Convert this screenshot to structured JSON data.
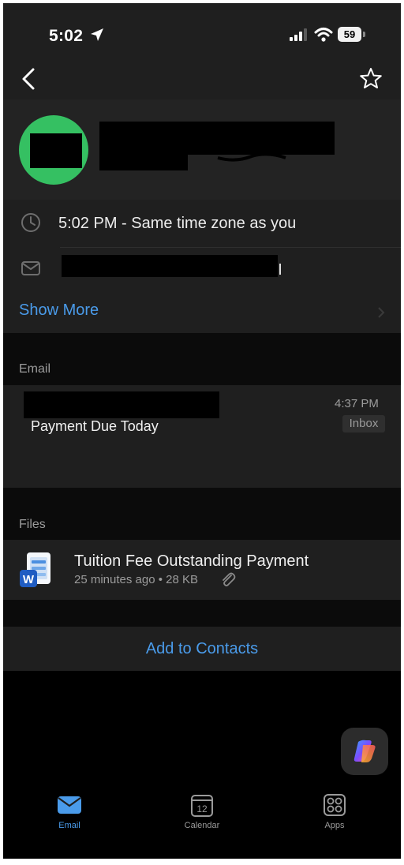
{
  "status_bar": {
    "time": "5:02",
    "battery": "59"
  },
  "contact": {
    "local_time": "5:02 PM - Same time zone as you",
    "show_more": "Show More"
  },
  "email_section": {
    "label": "Email",
    "items": [
      {
        "subject": "Payment Due Today",
        "time": "4:37 PM",
        "folder": "Inbox"
      }
    ]
  },
  "files_section": {
    "label": "Files",
    "items": [
      {
        "name": "Tuition Fee Outstanding Payment",
        "meta": "25 minutes ago • 28 KB",
        "icon": "word-doc-icon"
      }
    ]
  },
  "actions": {
    "add_to_contacts": "Add to Contacts"
  },
  "tab_bar": {
    "tabs": [
      {
        "label": "Email",
        "icon": "mail-icon",
        "active": true
      },
      {
        "label": "Calendar",
        "icon": "calendar-icon",
        "date": "12",
        "active": false
      },
      {
        "label": "Apps",
        "icon": "apps-grid-icon",
        "active": false
      }
    ]
  },
  "colors": {
    "accent": "#4a9bea",
    "avatar": "#35c062",
    "background": "#1f1f1f"
  }
}
